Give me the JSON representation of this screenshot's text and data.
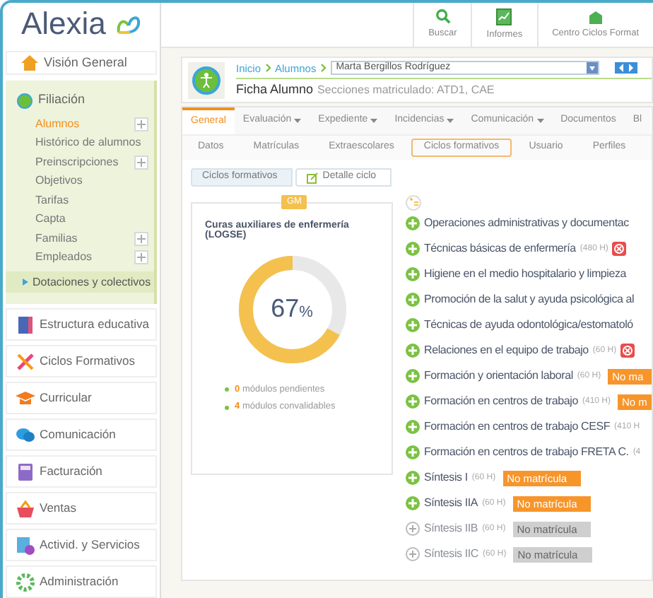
{
  "logo": {
    "text": "Alexia"
  },
  "toolbar": [
    {
      "label": "Buscar",
      "kind": "search"
    },
    {
      "label": "Informes",
      "kind": "report"
    },
    {
      "label": "Centro Ciclos Format",
      "kind": "center"
    }
  ],
  "sidebar": {
    "top": {
      "label": "Visión General"
    },
    "section": {
      "label": "Filiación",
      "items": [
        {
          "label": "Alumnos",
          "selected": true,
          "addable": true
        },
        {
          "label": "Histórico de alumnos",
          "selected": false,
          "addable": false
        },
        {
          "label": "Preinscripciones",
          "selected": false,
          "addable": true
        },
        {
          "label": "Objetivos",
          "selected": false,
          "addable": false
        },
        {
          "label": "Tarifas",
          "selected": false,
          "addable": false
        },
        {
          "label": "Capta",
          "selected": false,
          "addable": false
        },
        {
          "label": "Familias",
          "selected": false,
          "addable": true
        },
        {
          "label": "Empleados",
          "selected": false,
          "addable": true
        }
      ],
      "sub_item": {
        "label": "Dotaciones y colectivos"
      }
    },
    "modules": [
      {
        "label": "Estructura educativa",
        "kind": "book"
      },
      {
        "label": "Ciclos Formativos",
        "kind": "tools"
      },
      {
        "label": "Curricular",
        "kind": "cap"
      },
      {
        "label": "Comunicación",
        "kind": "chat"
      },
      {
        "label": "Facturación",
        "kind": "calc"
      },
      {
        "label": "Ventas",
        "kind": "basket"
      },
      {
        "label": "Activid. y Servicios",
        "kind": "services"
      },
      {
        "label": "Administración",
        "kind": "gear"
      }
    ]
  },
  "breadcrumb": [
    "Inicio",
    "Alumnos"
  ],
  "student_field": {
    "value": "Marta Bergillos Rodríguez"
  },
  "page_title": "Ficha Alumno",
  "sections": "Secciones matriculado: ATD1, CAE",
  "tabs": [
    {
      "label": "General",
      "selected": true,
      "menu": false
    },
    {
      "label": "Evaluación",
      "selected": false,
      "menu": true
    },
    {
      "label": "Expediente",
      "selected": false,
      "menu": true
    },
    {
      "label": "Incidencias",
      "selected": false,
      "menu": true
    },
    {
      "label": "Comunicación",
      "selected": false,
      "menu": true
    },
    {
      "label": "Documentos",
      "selected": false,
      "menu": false
    },
    {
      "label": "Bl",
      "selected": false,
      "menu": false
    }
  ],
  "subtabs": [
    {
      "label": "Datos",
      "selected": false
    },
    {
      "label": "Matrículas",
      "selected": false
    },
    {
      "label": "Extraescolares",
      "selected": false
    },
    {
      "label": "Ciclos formativos",
      "selected": true
    },
    {
      "label": "Usuario",
      "selected": false
    },
    {
      "label": "Perfiles",
      "selected": false
    }
  ],
  "steps": [
    {
      "label": "Ciclos formativos",
      "selected": true
    },
    {
      "label": "Detalle ciclo",
      "selected": false
    }
  ],
  "cycle_card": {
    "badge": "GM",
    "title": "Curas auxiliares de enfermería (LOGSE)",
    "percent": "67",
    "unit": "%",
    "level": 0.67,
    "stats": [
      {
        "count": "0",
        "label": "módulos pendientes"
      },
      {
        "count": "4",
        "label": "módulos convalidables"
      }
    ]
  },
  "modules_list": [
    {
      "name": "Operaciones administrativas y documentac",
      "enabled": true
    },
    {
      "name": "Técnicas básicas de enfermería",
      "hours": "(480 H)",
      "enabled": true,
      "error": true
    },
    {
      "name": "Higiene en el medio hospitalario y limpieza",
      "enabled": true
    },
    {
      "name": "Promoción de la salut y ayuda psicológica al",
      "enabled": true
    },
    {
      "name": "Técnicas de ayuda odontológica/estomatoló",
      "enabled": true
    },
    {
      "name": "Relaciones en el equipo de trabajo",
      "hours": "(60 H)",
      "enabled": true,
      "error": true
    },
    {
      "name": "Formación y orientación laboral",
      "hours": "(60 H)",
      "enabled": true,
      "status": {
        "label": "No ma",
        "kind": "orange"
      }
    },
    {
      "name": "Formación en centros de trabajo",
      "hours": "(410 H)",
      "enabled": true,
      "status": {
        "label": "No m",
        "kind": "orange"
      }
    },
    {
      "name": "Formación en centros de trabajo CESF",
      "hours": "(410 H",
      "enabled": true
    },
    {
      "name": "Formación en centros de trabajo FRETA C.",
      "hours": "(4",
      "enabled": true
    },
    {
      "name": "Síntesis I",
      "hours": "(60 H)",
      "enabled": true,
      "status": {
        "label": "No matrícula",
        "kind": "orange"
      }
    },
    {
      "name": "Síntesis IIA",
      "hours": "(60 H)",
      "enabled": true,
      "status": {
        "label": "No matrícula",
        "kind": "orange"
      }
    },
    {
      "name": "Síntesis IIB",
      "hours": "(60 H)",
      "enabled": false,
      "status": {
        "label": "No matrícula",
        "kind": "grey"
      }
    },
    {
      "name": "Síntesis IIC",
      "hours": "(60 H)",
      "enabled": false,
      "status": {
        "label": "No matrícula",
        "kind": "grey"
      }
    }
  ]
}
